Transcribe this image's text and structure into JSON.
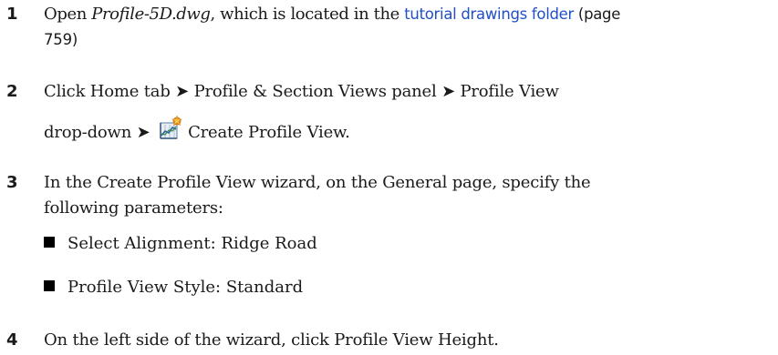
{
  "steps": [
    {
      "number": "1",
      "line1_prefix": "Open ",
      "filename": "Profile-5D.dwg",
      "line1_mid": ", which is located in the ",
      "link_text": "tutorial drawings folder",
      "line1_suffix": " (page",
      "line2": "759)"
    },
    {
      "number": "2",
      "line1": "Click Home tab ➤ Profile & Section Views panel ➤ Profile View",
      "line2_prefix": "drop-down ➤ ",
      "icon": "create-profile-view-icon",
      "line2_suffix": "Create Profile View."
    },
    {
      "number": "3",
      "line1": "In the Create Profile View wizard, on the General page, specify the",
      "line2": "following parameters:",
      "bullets": [
        "Select Alignment: Ridge Road",
        "Profile View Style: Standard"
      ]
    },
    {
      "number": "4",
      "line1": "On the left side of the wizard, click Profile View Height."
    }
  ]
}
